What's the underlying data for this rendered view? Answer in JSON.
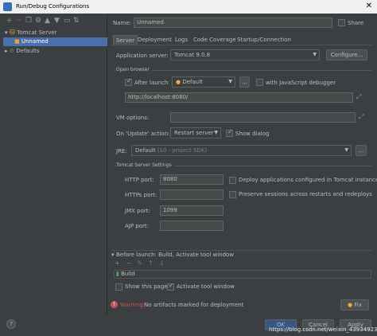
{
  "window": {
    "title": "Run/Debug Configurations",
    "close": "✕"
  },
  "tree": {
    "toolbar_icons": [
      "add-icon",
      "remove-icon",
      "copy-icon",
      "settings-icon",
      "move-up-icon",
      "move-down-icon",
      "folder-icon",
      "sort-icon"
    ],
    "items": [
      {
        "label": "Tomcat Server",
        "expanded": true
      },
      {
        "label": "Unnamed",
        "selected": true
      },
      {
        "label": "Defaults",
        "expanded": false
      }
    ]
  },
  "header": {
    "name_label": "Name:",
    "name_value": "Unnamed",
    "share_label": "Share"
  },
  "tabs": [
    "Server",
    "Deployment",
    "Logs",
    "Code Coverage",
    "Startup/Connection"
  ],
  "server": {
    "app_server_label": "Application server:",
    "app_server_value": "Tomcat 9.0.8",
    "configure_button": "Configure...",
    "open_browser_title": "Open browser",
    "after_launch_label": "After launch",
    "browser_value": "Default",
    "browse_button": "...",
    "js_debugger_label": "with JavaScript debugger",
    "url_value": "http://localhost:8080/",
    "vm_options_label": "VM options:",
    "on_update_label": "On 'Update' action:",
    "on_update_value": "Restart server",
    "show_dialog_label": "Show dialog",
    "jre_label": "JRE:",
    "jre_value": "Default",
    "jre_hint": "(10 - project SDK)",
    "tomcat_settings_title": "Tomcat Server Settings",
    "http_port_label": "HTTP port:",
    "http_port_value": "8080",
    "https_port_label": "HTTPs port:",
    "https_port_value": "",
    "jmx_port_label": "JMX port:",
    "jmx_port_value": "1099",
    "ajp_port_label": "AJP port:",
    "ajp_port_value": "",
    "deploy_configured_label": "Deploy applications configured in Tomcat instance",
    "preserve_sessions_label": "Preserve sessions across restarts and redeploys"
  },
  "before_launch": {
    "title": "Before launch: Build, Activate tool window",
    "task": "Build",
    "show_page_label": "Show this page",
    "activate_tool_label": "Activate tool window"
  },
  "warning": {
    "label": "Warning:",
    "text": "No artifacts marked for deployment",
    "fix_button": "Fix"
  },
  "footer": {
    "help_icon": "?",
    "ok_button": "OK",
    "cancel_button": "Cancel",
    "apply_button": "Apply",
    "watermark": "https://blog.csdn.net/weixin_43934923"
  },
  "colors": {
    "accent": "#4b6eaf",
    "panel": "#3c3f41",
    "field": "#45494a",
    "warning": "#c75450"
  }
}
